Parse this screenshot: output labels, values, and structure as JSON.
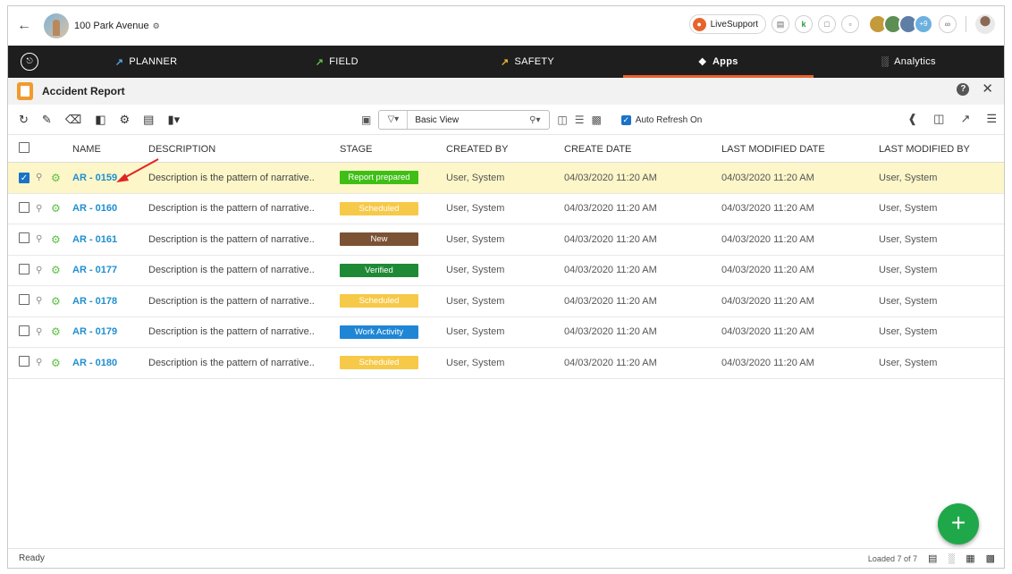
{
  "header": {
    "project_name": "100 Park Avenue",
    "live_support": "LiveSupport",
    "more_count": "+9"
  },
  "nav": {
    "tabs": [
      {
        "label": "PLANNER"
      },
      {
        "label": "FIELD"
      },
      {
        "label": "SAFETY"
      },
      {
        "label": "Apps"
      },
      {
        "label": "Analytics"
      }
    ],
    "active": "Apps"
  },
  "title": "Accident Report",
  "toolbar": {
    "view": "Basic View",
    "auto_refresh": "Auto Refresh On"
  },
  "table": {
    "headers": {
      "name": "NAME",
      "description": "DESCRIPTION",
      "stage": "STAGE",
      "created_by": "CREATED BY",
      "create_date": "CREATE DATE",
      "modified_date": "LAST MODIFIED DATE",
      "modified_by": "LAST MODIFIED BY"
    },
    "rows": [
      {
        "name": "AR - 0159",
        "desc": "Description is the pattern of narrative..",
        "stage": "Report prepared",
        "by": "User, System",
        "cdate": "04/03/2020 11:20 AM",
        "mdate": "04/03/2020 11:20 AM",
        "mby": "User, System"
      },
      {
        "name": "AR - 0160",
        "desc": "Description is the pattern of narrative..",
        "stage": "Scheduled",
        "by": "User, System",
        "cdate": "04/03/2020 11:20 AM",
        "mdate": "04/03/2020 11:20 AM",
        "mby": "User, System"
      },
      {
        "name": "AR - 0161",
        "desc": "Description is the pattern of narrative..",
        "stage": "New",
        "by": "User, System",
        "cdate": "04/03/2020 11:20 AM",
        "mdate": "04/03/2020 11:20 AM",
        "mby": "User, System"
      },
      {
        "name": "AR - 0177",
        "desc": "Description is the pattern of narrative..",
        "stage": "Verified",
        "by": "User, System",
        "cdate": "04/03/2020 11:20 AM",
        "mdate": "04/03/2020 11:20 AM",
        "mby": "User, System"
      },
      {
        "name": "AR - 0178",
        "desc": "Description is the pattern of narrative..",
        "stage": "Scheduled",
        "by": "User, System",
        "cdate": "04/03/2020 11:20 AM",
        "mdate": "04/03/2020 11:20 AM",
        "mby": "User, System"
      },
      {
        "name": "AR - 0179",
        "desc": "Description is the pattern of narrative..",
        "stage": "Work Activity",
        "by": "User, System",
        "cdate": "04/03/2020 11:20 AM",
        "mdate": "04/03/2020 11:20 AM",
        "mby": "User, System"
      },
      {
        "name": "AR - 0180",
        "desc": "Description is the pattern of narrative..",
        "stage": "Scheduled",
        "by": "User, System",
        "cdate": "04/03/2020 11:20 AM",
        "mdate": "04/03/2020 11:20 AM",
        "mby": "User, System"
      }
    ]
  },
  "stage_colors": {
    "report_prepared": "#3fbf16",
    "scheduled": "#f7c948",
    "new": "#7b5234",
    "verified": "#1f8a35",
    "work_activity": "#1f86d6"
  },
  "footer": {
    "status": "Ready",
    "loaded": "Loaded 7 of 7"
  },
  "colors": {
    "accent": "#e8632b",
    "link": "#1f8fcf",
    "fab": "#1fa84a",
    "selected_row": "#fdf6c8"
  }
}
